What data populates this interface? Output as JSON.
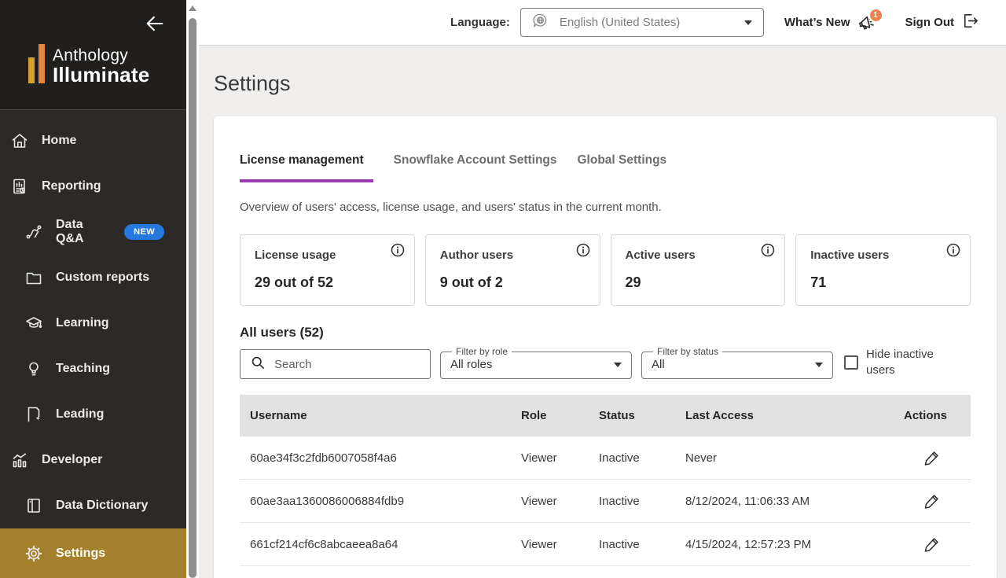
{
  "sidebar": {
    "brand_line1": "Anthology",
    "brand_line2": "Illuminate",
    "items": [
      {
        "label": "Home"
      },
      {
        "label": "Reporting"
      },
      {
        "label": "Data Q&A",
        "badge": "NEW"
      },
      {
        "label": "Custom reports"
      },
      {
        "label": "Learning"
      },
      {
        "label": "Teaching"
      },
      {
        "label": "Leading"
      },
      {
        "label": "Developer"
      },
      {
        "label": "Data Dictionary"
      },
      {
        "label": "Settings"
      }
    ]
  },
  "topbar": {
    "language_label": "Language:",
    "language_value": "English (United States)",
    "whats_new_label": "What’s New",
    "whats_new_badge": "1",
    "sign_out_label": "Sign Out"
  },
  "page": {
    "title": "Settings",
    "tabs": [
      {
        "label": "License management"
      },
      {
        "label": "Snowflake Account Settings"
      },
      {
        "label": "Global Settings"
      }
    ],
    "overview_text": "Overview of users' access, license usage, and users' status in the current month."
  },
  "stat_cards": [
    {
      "title": "License usage",
      "value": "29 out of 52"
    },
    {
      "title": "Author users",
      "value": "9 out of 2"
    },
    {
      "title": "Active users",
      "value": "29"
    },
    {
      "title": "Inactive users",
      "value": "71"
    }
  ],
  "users": {
    "heading": "All users (52)",
    "search_placeholder": "Search",
    "filter_role_label": "Filter by role",
    "filter_role_value": "All roles",
    "filter_status_label": "Filter by status",
    "filter_status_value": "All",
    "hide_inactive_label": "Hide inactive users"
  },
  "table": {
    "columns": [
      "Username",
      "Role",
      "Status",
      "Last Access",
      "Actions"
    ],
    "rows": [
      {
        "username": "60ae34f3c2fdb6007058f4a6",
        "role": "Viewer",
        "status": "Inactive",
        "last_access": "Never"
      },
      {
        "username": "60ae3aa1360086006884fdb9",
        "role": "Viewer",
        "status": "Inactive",
        "last_access": "8/12/2024, 11:06:33 AM"
      },
      {
        "username": "661cf214cf6c8abcaeea8a64",
        "role": "Viewer",
        "status": "Inactive",
        "last_access": "4/15/2024, 12:57:23 PM"
      }
    ]
  },
  "colors": {
    "sidebar_active_gold": "#a5802c",
    "tab_accent_purple": "#9b3bb0",
    "new_badge_blue": "#2478e0",
    "notification_orange": "#f0814d",
    "logo_gold": "#d7a12f",
    "logo_orange": "#e2873b"
  }
}
